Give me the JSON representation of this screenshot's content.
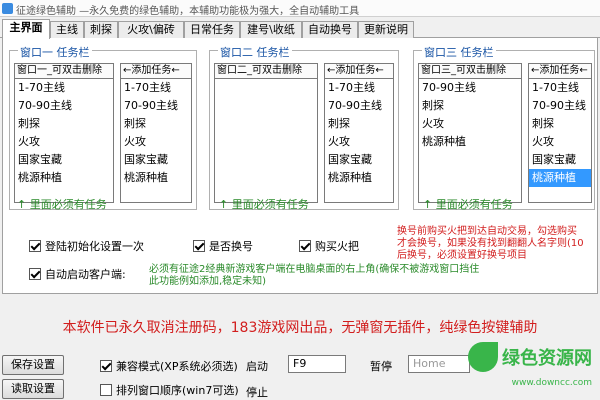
{
  "window": {
    "title": "征途绿色辅助 —永久免费的绿色辅助，本辅助功能极为强大，全自动辅助工具"
  },
  "tabs": [
    "主界面",
    "主线",
    "刺探",
    "火攻\\偏砖",
    "日常任务",
    "建号\\收纸",
    "自动换号",
    "更新说明"
  ],
  "groups": [
    {
      "title": "窗口一   任务栏",
      "list_header": "窗口一_可双击删除",
      "list_items": [
        "1-70主线",
        "70-90主线",
        "刺探",
        "火攻",
        "国家宝藏",
        "桃源种植"
      ],
      "add_header": "←添加任务←",
      "add_items": [
        "1-70主线",
        "70-90主线",
        "刺探",
        "火攻",
        "国家宝藏",
        "桃源种植"
      ]
    },
    {
      "title": "窗口二   任务栏",
      "list_header": "窗口二_可双击删除",
      "list_items": [],
      "add_header": "←添加任务←",
      "add_items": [
        "1-70主线",
        "70-90主线",
        "刺探",
        "火攻",
        "国家宝藏",
        "桃源种植"
      ]
    },
    {
      "title": "窗口三   任务栏",
      "list_header": "窗口三_可双击删除",
      "list_items": [
        "70-90主线",
        "刺探",
        "火攻",
        "桃源种植"
      ],
      "add_header": "←添加任务←",
      "add_items": [
        "1-70主线",
        "70-90主线",
        "刺探",
        "火攻",
        "国家宝藏",
        "桃源种植"
      ],
      "add_selected_index": 5
    }
  ],
  "hint": "↑ 里面必须有任务",
  "options": {
    "init_once": {
      "label": "登陆初始化设置一次",
      "checked": true
    },
    "switch_account": {
      "label": "是否换号",
      "checked": true
    },
    "buy_torch": {
      "label": "购买火把",
      "checked": true
    },
    "auto_start_client": {
      "label": "自动启动客户端:",
      "checked": true
    }
  },
  "notes": {
    "red_line1": "换号前购买火把到达自动交易，勾选购买",
    "red_line2": "才会换号，如果没有找到翻翻人名字则(10",
    "red_line3": "后换号，必须设置好换号项目",
    "green_line1": "必须有征途2经典新游戏客户端在电脑桌面的右上角(确保不被游戏窗口挡住",
    "green_line2": "此功能例如添加,稳定未知)"
  },
  "banner": "本软件已永久取消注册码，183游戏网出品，无弹窗无插件，纯绿色按键辅助",
  "bottom": {
    "save_button": "保存设置",
    "load_button": "读取设置",
    "compat_mode": {
      "label": "兼容模式(XP系统必须选)",
      "checked": true
    },
    "window_order": {
      "label": "排列窗口顺序(win7可选)",
      "checked": false
    },
    "start_label": "启动",
    "start_key": "F9",
    "pause_label": "暂停",
    "pause_key": "Home",
    "stop_label": "停止"
  },
  "watermark": {
    "text": "绿色资源网",
    "url": "www.downcc.com"
  },
  "colors": {
    "group_title": "#1a55a5",
    "hint_green": "#2a8a2a",
    "note_red": "#d21e1e",
    "selection": "#3399ff",
    "watermark": "#39b54a"
  }
}
